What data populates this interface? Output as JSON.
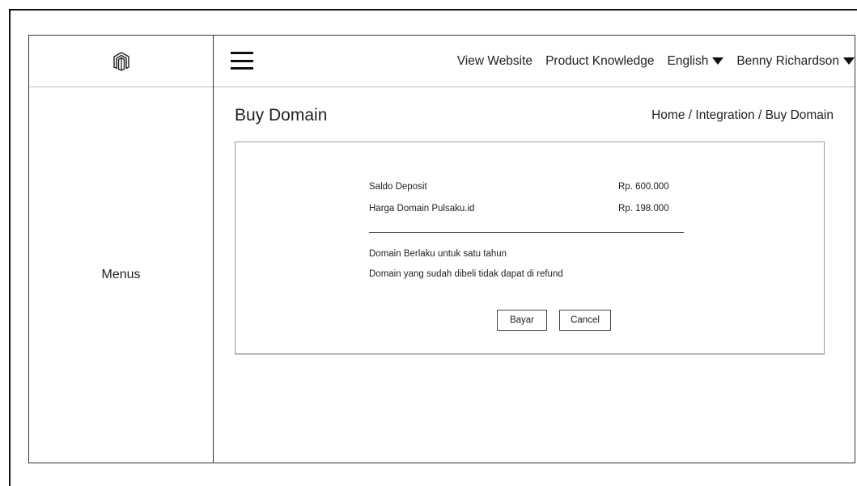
{
  "sidebar": {
    "logo_icon": "brand-logo-icon",
    "menus_label": "Menus"
  },
  "header": {
    "menu_icon": "hamburger-icon",
    "nav": {
      "view_website": "View Website",
      "product_knowledge": "Product Knowledge",
      "language": "English",
      "user": "Benny Richardson"
    }
  },
  "page": {
    "title": "Buy Domain",
    "breadcrumb": {
      "home": "Home",
      "sep": " / ",
      "integration": "Integration",
      "current": "Buy Domain"
    }
  },
  "purchase": {
    "rows": [
      {
        "label": "Saldo Deposit",
        "value": "Rp. 600.000"
      },
      {
        "label": "Harga Domain Pulsaku.id",
        "value": "Rp. 198.000"
      }
    ],
    "notes": [
      "Domain Berlaku untuk satu tahun",
      "Domain yang sudah dibeli tidak dapat di refund"
    ],
    "pay_label": "Bayar",
    "cancel_label": "Cancel"
  }
}
